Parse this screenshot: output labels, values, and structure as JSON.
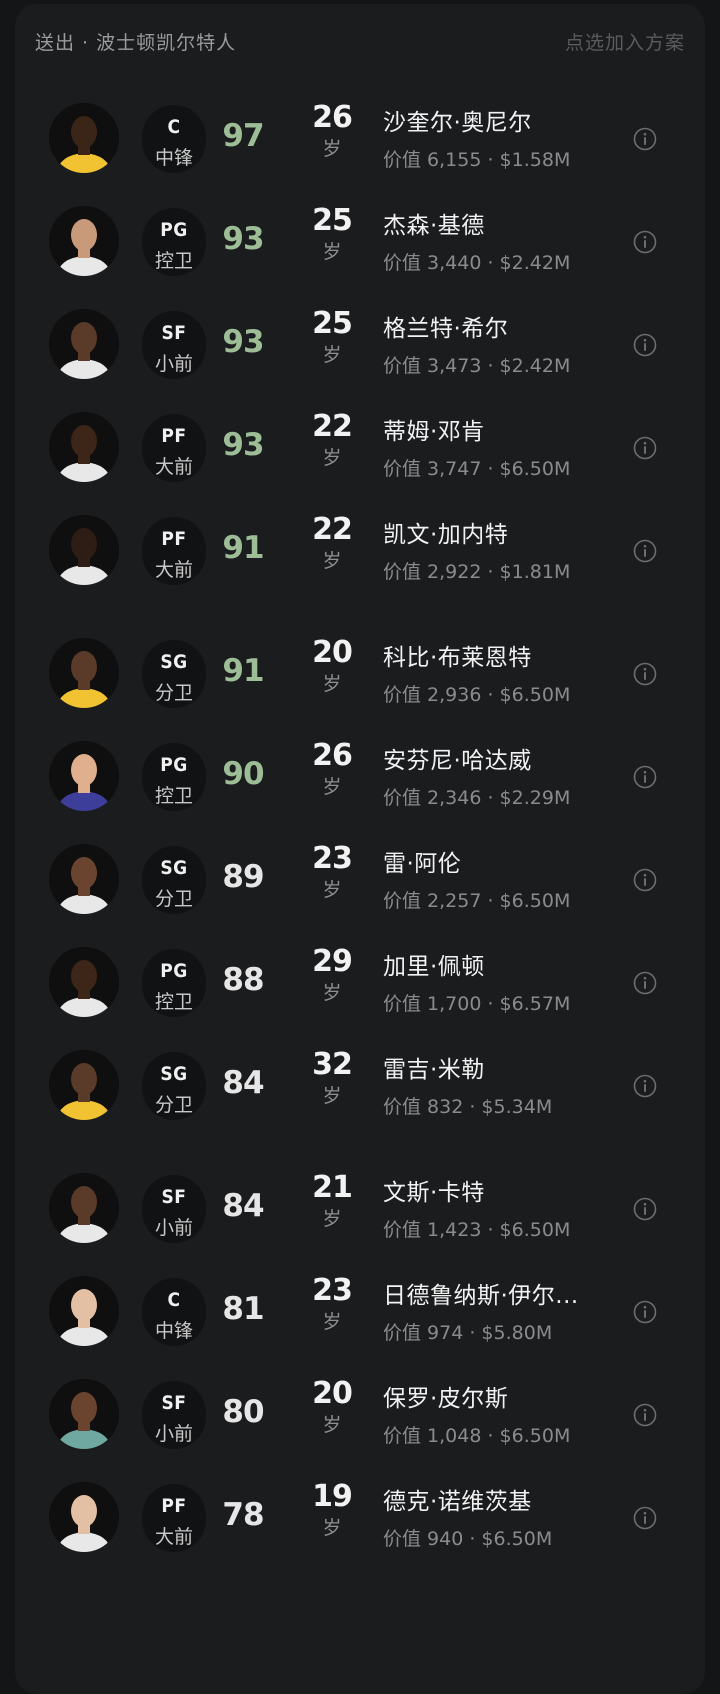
{
  "header": {
    "title": "送出 · 波士顿凯尔特人",
    "action": "点选加入方案"
  },
  "colors": {
    "rating_high": "#9dbd96",
    "rating_normal": "#e6e6e6"
  },
  "players": [
    {
      "name": "沙奎尔·奥尼尔",
      "pos": "C",
      "pos_cn": "中锋",
      "ovr": "97",
      "age": "26",
      "age_unit": "岁",
      "value": "价值 6,155 · $1.58M",
      "jersey": "#f1c232",
      "skin": "#3b2518",
      "rating_color": "high"
    },
    {
      "name": "杰森·基德",
      "pos": "PG",
      "pos_cn": "控卫",
      "ovr": "93",
      "age": "25",
      "age_unit": "岁",
      "value": "价值 3,440 · $2.42M",
      "jersey": "#e8e8e8",
      "skin": "#c89a7a",
      "rating_color": "high"
    },
    {
      "name": "格兰特·希尔",
      "pos": "SF",
      "pos_cn": "小前",
      "ovr": "93",
      "age": "25",
      "age_unit": "岁",
      "value": "价值 3,473 · $2.42M",
      "jersey": "#e8e8e8",
      "skin": "#5a3a28",
      "rating_color": "high"
    },
    {
      "name": "蒂姆·邓肯",
      "pos": "PF",
      "pos_cn": "大前",
      "ovr": "93",
      "age": "22",
      "age_unit": "岁",
      "value": "价值 3,747 · $6.50M",
      "jersey": "#e8e8e8",
      "skin": "#3d2618",
      "rating_color": "high"
    },
    {
      "name": "凯文·加内特",
      "pos": "PF",
      "pos_cn": "大前",
      "ovr": "91",
      "age": "22",
      "age_unit": "岁",
      "value": "价值 2,922 · $1.81M",
      "jersey": "#e8e8e8",
      "skin": "#2e1d14",
      "rating_color": "high"
    },
    {
      "name": "科比·布莱恩特",
      "pos": "SG",
      "pos_cn": "分卫",
      "ovr": "91",
      "age": "20",
      "age_unit": "岁",
      "value": "价值 2,936 · $6.50M",
      "jersey": "#f1c232",
      "skin": "#5a3a28",
      "rating_color": "high"
    },
    {
      "name": "安芬尼·哈达威",
      "pos": "PG",
      "pos_cn": "控卫",
      "ovr": "90",
      "age": "26",
      "age_unit": "岁",
      "value": "价值 2,346 · $2.29M",
      "jersey": "#3d3d9a",
      "skin": "#e0b08e",
      "rating_color": "high"
    },
    {
      "name": "雷·阿伦",
      "pos": "SG",
      "pos_cn": "分卫",
      "ovr": "89",
      "age": "23",
      "age_unit": "岁",
      "value": "价值 2,257 · $6.50M",
      "jersey": "#e8e8e8",
      "skin": "#6b4430",
      "rating_color": "normal"
    },
    {
      "name": "加里·佩顿",
      "pos": "PG",
      "pos_cn": "控卫",
      "ovr": "88",
      "age": "29",
      "age_unit": "岁",
      "value": "价值 1,700 · $6.57M",
      "jersey": "#e8e8e8",
      "skin": "#3d2618",
      "rating_color": "normal"
    },
    {
      "name": "雷吉·米勒",
      "pos": "SG",
      "pos_cn": "分卫",
      "ovr": "84",
      "age": "32",
      "age_unit": "岁",
      "value": "价值 832 · $5.34M",
      "jersey": "#f1c232",
      "skin": "#5a3a28",
      "rating_color": "normal"
    },
    {
      "name": "文斯·卡特",
      "pos": "SF",
      "pos_cn": "小前",
      "ovr": "84",
      "age": "21",
      "age_unit": "岁",
      "value": "价值 1,423 · $6.50M",
      "jersey": "#e8e8e8",
      "skin": "#5a3a28",
      "rating_color": "normal"
    },
    {
      "name": "日德鲁纳斯·伊尔...",
      "pos": "C",
      "pos_cn": "中锋",
      "ovr": "81",
      "age": "23",
      "age_unit": "岁",
      "value": "价值 974 · $5.80M",
      "jersey": "#e8e8e8",
      "skin": "#e3bfa3",
      "rating_color": "normal"
    },
    {
      "name": "保罗·皮尔斯",
      "pos": "SF",
      "pos_cn": "小前",
      "ovr": "80",
      "age": "20",
      "age_unit": "岁",
      "value": "价值 1,048 · $6.50M",
      "jersey": "#6fa8a0",
      "skin": "#6b4430",
      "rating_color": "normal"
    },
    {
      "name": "德克·诺维茨基",
      "pos": "PF",
      "pos_cn": "大前",
      "ovr": "78",
      "age": "19",
      "age_unit": "岁",
      "value": "价值 940 · $6.50M",
      "jersey": "#e8e8e8",
      "skin": "#e3bfa3",
      "rating_color": "normal"
    }
  ]
}
